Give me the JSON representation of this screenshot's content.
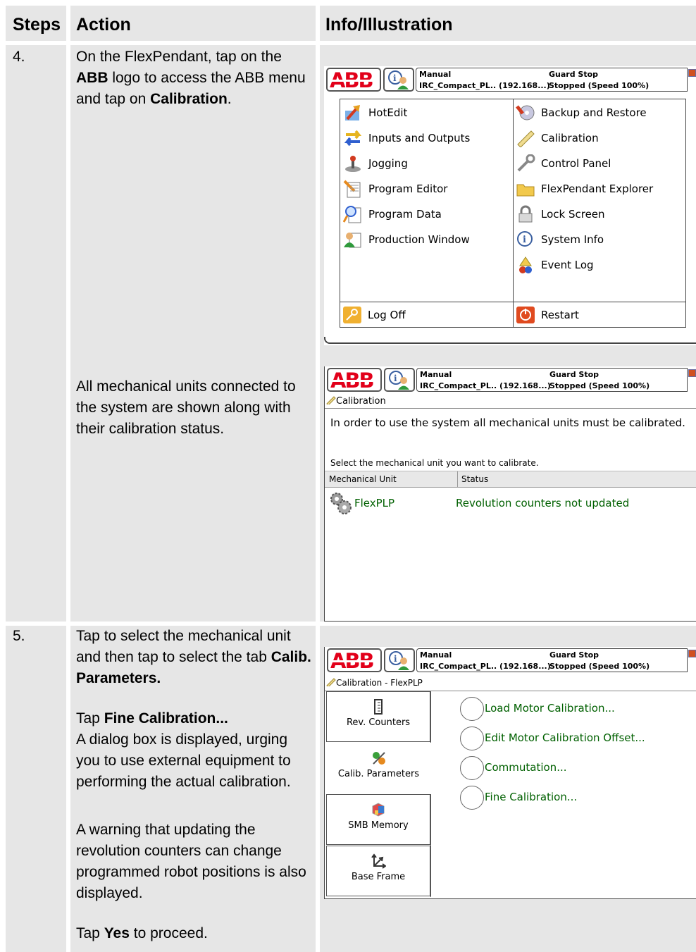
{
  "table": {
    "headers": {
      "steps": "Steps",
      "action": "Action",
      "info": "Info/Illustration"
    },
    "row4": {
      "step": "4.",
      "action1_a": "On the FlexPendant, tap on the ",
      "action1_b": "ABB",
      "action1_c": " logo to access the ABB menu and tap on ",
      "action1_d": "Calibration",
      "action1_e": ".",
      "action2": "All mechanical units connected to the system are shown along with their calibration status."
    },
    "row5": {
      "step": "5.",
      "p1_a": "Tap to select the mechanical unit and then tap to select the tab ",
      "p1_b": "Calib. Parameters.",
      "p2_a": "Tap ",
      "p2_b": "Fine Calibration...",
      "p2_c": "A dialog box is displayed, urging you to use external equipment to performing the actual calibration.",
      "p3": "A warning that updating the revolution counters can change programmed robot positions is also displayed.",
      "p4_a": "Tap ",
      "p4_b": "Yes",
      "p4_c": " to proceed."
    }
  },
  "pendant": {
    "logo": "ABB",
    "mode": "Manual",
    "system": "IRC_Compact_PL.. (192.168...)",
    "state": "Guard Stop",
    "speed": "Stopped (Speed 100%)"
  },
  "abb_menu": {
    "left": [
      "HotEdit",
      "Inputs and Outputs",
      "Jogging",
      "Program Editor",
      "Program Data",
      "Production Window"
    ],
    "right": [
      "Backup and Restore",
      "Calibration",
      "Control Panel",
      "FlexPendant Explorer",
      "Lock Screen",
      "System Info",
      "Event Log"
    ],
    "log_off": "Log Off",
    "restart": "Restart"
  },
  "calibration_screen": {
    "title": "Calibration",
    "message": "In order to use the system all mechanical units must be calibrated.",
    "select_prompt": "Select the mechanical unit you want to calibrate.",
    "columns": [
      "Mechanical Unit",
      "Status"
    ],
    "unit": "FlexPLP",
    "status": "Revolution counters not updated"
  },
  "calib_params_screen": {
    "title": "Calibration - FlexPLP",
    "tabs": [
      "Rev. Counters",
      "Calib. Parameters",
      "SMB Memory",
      "Base Frame"
    ],
    "options": [
      "Load Motor Calibration...",
      "Edit Motor Calibration Offset...",
      "Commutation...",
      "Fine Calibration..."
    ]
  },
  "colors": {
    "abb_red": "#e2001a",
    "link_green": "#006000",
    "panel_gray": "#e6e6e6"
  }
}
